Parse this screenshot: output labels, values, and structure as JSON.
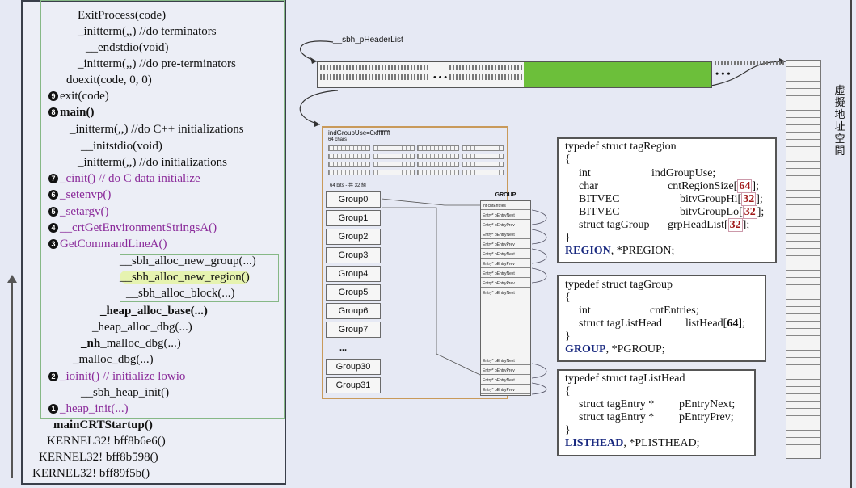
{
  "stack": {
    "lines": [
      {
        "text": "ExitProcess(code)"
      },
      {
        "text": "_initterm(,,)   //do terminators"
      },
      {
        "text": "__endstdio(void)"
      },
      {
        "text": "_initterm(,,)   //do pre-terminators"
      },
      {
        "text": "doexit(code, 0, 0)"
      },
      {
        "text": "exit(code)",
        "num": "9"
      },
      {
        "text": "main()",
        "num": "8"
      },
      {
        "text": "_initterm(,,)   //do C++ initializations"
      },
      {
        "text": "__initstdio(void)"
      },
      {
        "text": "_initterm(,,)   //do initializations"
      },
      {
        "text": "_cinit()   // do C data initialize",
        "num": "7"
      },
      {
        "text": "_setenvp()",
        "num": "6"
      },
      {
        "text": "_setargv()",
        "num": "5"
      },
      {
        "text": "__crtGetEnvironmentStringsA()",
        "num": "4"
      },
      {
        "text": "GetCommandLineA()",
        "num": "3"
      },
      {
        "text": "__sbh_alloc_new_group(...)"
      },
      {
        "text": "__sbh_alloc_new_region()"
      },
      {
        "text": "__sbh_alloc_block(...)"
      },
      {
        "text": "_heap_alloc_base(...)"
      },
      {
        "text": "_heap_alloc_dbg(...)"
      },
      {
        "text": "_nh_malloc_dbg(...)"
      },
      {
        "text": "_malloc_dbg(...)"
      },
      {
        "text": "_ioinit()  // initialize lowio",
        "num": "2"
      },
      {
        "text": "__sbh_heap_init()"
      },
      {
        "text": "_heap_init(...)",
        "num": "1"
      },
      {
        "text": "mainCRTStartup()"
      },
      {
        "text": "KERNEL32! bff8b6e6()"
      },
      {
        "text": "KERNEL32! bff8b598()"
      },
      {
        "text": "KERNEL32! bff89f5b()"
      }
    ]
  },
  "header_list": {
    "label": "__sbh_pHeaderList",
    "dots": "• • •",
    "end_dots": "• • •"
  },
  "region": {
    "ind_label": "indGroupUse=0xffffffff",
    "chars_label": "64 chars",
    "bits_label": "64 bits - 共 32 組",
    "groups": [
      "Group0",
      "Group1",
      "Group2",
      "Group3",
      "Group4",
      "Group5",
      "Group6",
      "Group7",
      "...",
      "Group30",
      "Group31"
    ]
  },
  "group": {
    "title": "GROUP",
    "first_row": "int cntEntries",
    "row_label": "Entry* pEntryNext",
    "row_label2": "Entry* pEntryPrev"
  },
  "tagRegion": {
    "head": "typedef struct tagRegion",
    "open": "{",
    "f1a": "int",
    "f1b": "indGroupUse;",
    "f2a": "char",
    "f2b": "cntRegionSize[",
    "f2n": "64",
    "f2c": "];",
    "f3a": "BITVEC",
    "f3b": "bitvGroupHi[",
    "f3n": "32",
    "f3c": "];",
    "f4a": "BITVEC",
    "f4b": "bitvGroupLo[",
    "f4n": "32",
    "f4c": "];",
    "f5a": "struct tagGroup",
    "f5b": "grpHeadList[",
    "f5n": "32",
    "f5c": "];",
    "close": "}",
    "tail_b": "REGION",
    "tail": ", *PREGION;"
  },
  "tagGroup": {
    "head": "typedef struct tagGroup",
    "open": "{",
    "f1a": "int",
    "f1b": "cntEntries;",
    "f2a": "struct tagListHead",
    "f2b": "listHead[",
    "f2n": "64",
    "f2c": "];",
    "close": "}",
    "tail_b": "GROUP",
    "tail": ", *PGROUP;"
  },
  "tagListHead": {
    "head": "typedef struct tagListHead",
    "open": "{",
    "f1a": "struct tagEntry *",
    "f1b": "pEntryNext;",
    "f2a": "struct tagEntry *",
    "f2b": "pEntryPrev;",
    "close": "}",
    "tail_b": "LISTHEAD",
    "tail": ", *PLISTHEAD;"
  },
  "vaddr": {
    "chars": [
      "虛",
      "擬",
      "地",
      "址",
      "空",
      "間"
    ]
  }
}
